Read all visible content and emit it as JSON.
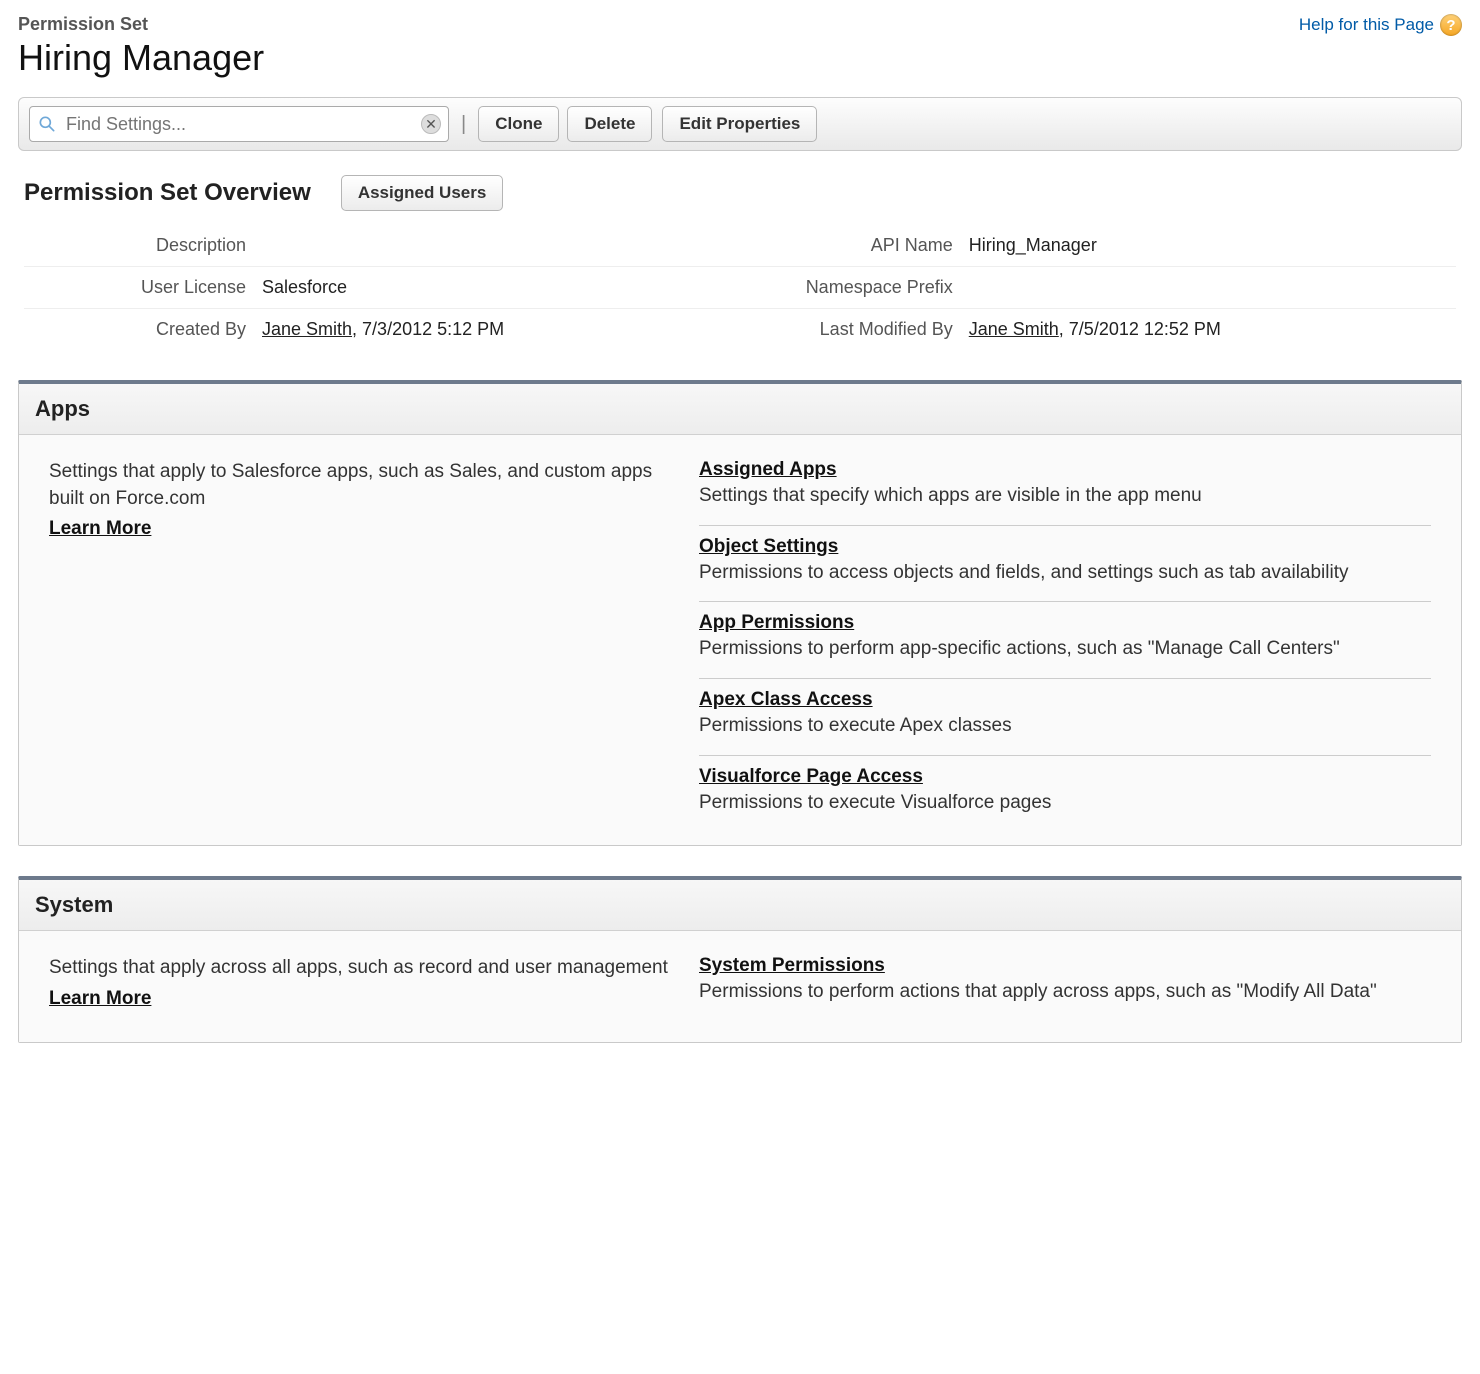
{
  "header": {
    "pretitle": "Permission Set",
    "title": "Hiring Manager",
    "help_label": "Help for this Page"
  },
  "toolbar": {
    "search_placeholder": "Find Settings...",
    "clone_label": "Clone",
    "delete_label": "Delete",
    "edit_properties_label": "Edit Properties"
  },
  "overview": {
    "heading": "Permission Set Overview",
    "assigned_users_label": "Assigned Users",
    "fields": {
      "description_label": "Description",
      "description_value": "",
      "api_name_label": "API Name",
      "api_name_value": "Hiring_Manager",
      "user_license_label": "User License",
      "user_license_value": "Salesforce",
      "namespace_prefix_label": "Namespace Prefix",
      "namespace_prefix_value": "",
      "created_by_label": "Created By",
      "created_by_user": "Jane Smith",
      "created_by_date": ", 7/3/2012 5:12 PM",
      "last_modified_by_label": "Last Modified By",
      "last_modified_by_user": "Jane Smith",
      "last_modified_by_date": ", 7/5/2012 12:52 PM"
    }
  },
  "apps_block": {
    "title": "Apps",
    "intro": "Settings that apply to Salesforce apps, such as Sales, and custom apps built on Force.com",
    "learn_more": "Learn More",
    "links": [
      {
        "title": "Assigned Apps",
        "desc": "Settings that specify which apps are visible in the app menu"
      },
      {
        "title": "Object Settings",
        "desc": "Permissions to access objects and fields, and settings such as tab availability"
      },
      {
        "title": "App Permissions",
        "desc": "Permissions to perform app-specific actions, such as \"Manage Call Centers\""
      },
      {
        "title": "Apex Class Access",
        "desc": "Permissions to execute Apex classes"
      },
      {
        "title": "Visualforce Page Access",
        "desc": "Permissions to execute Visualforce pages"
      }
    ]
  },
  "system_block": {
    "title": "System",
    "intro": "Settings that apply across all apps, such as record and user management",
    "learn_more": "Learn More",
    "links": [
      {
        "title": "System Permissions",
        "desc": "Permissions to perform actions that apply across apps, such as \"Modify All Data\""
      }
    ]
  }
}
